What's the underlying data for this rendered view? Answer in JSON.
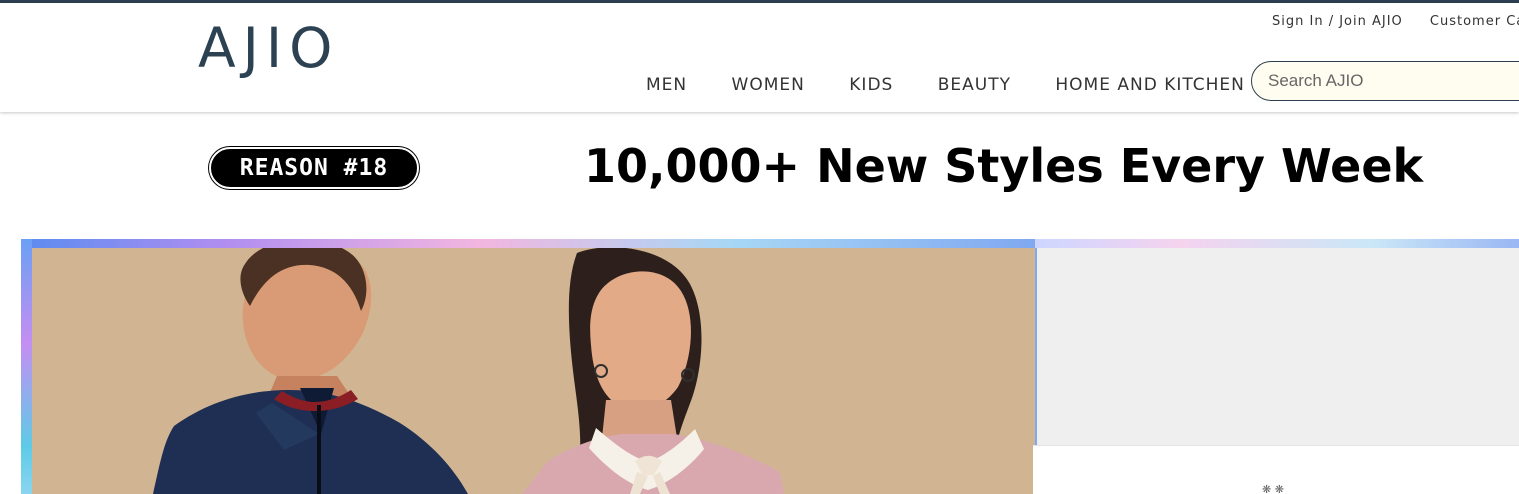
{
  "header": {
    "logo": "AJIO",
    "top_links": [
      "Sign In / Join AJIO",
      "Customer Care"
    ],
    "nav": [
      "MEN",
      "WOMEN",
      "KIDS",
      "BEAUTY",
      "HOME AND KITCHEN"
    ],
    "search_placeholder": "Search AJIO"
  },
  "promo": {
    "badge": "REASON #18",
    "tagline": "10,000+ New Styles Every Week"
  },
  "colors": {
    "brand": "#2c4152",
    "top_strip": "#2c3e50",
    "search_bg": "#fffdf0",
    "hero_bg": "#d2b595",
    "right_panel": "#efefef"
  },
  "loading_indicator": "❋ ❋"
}
